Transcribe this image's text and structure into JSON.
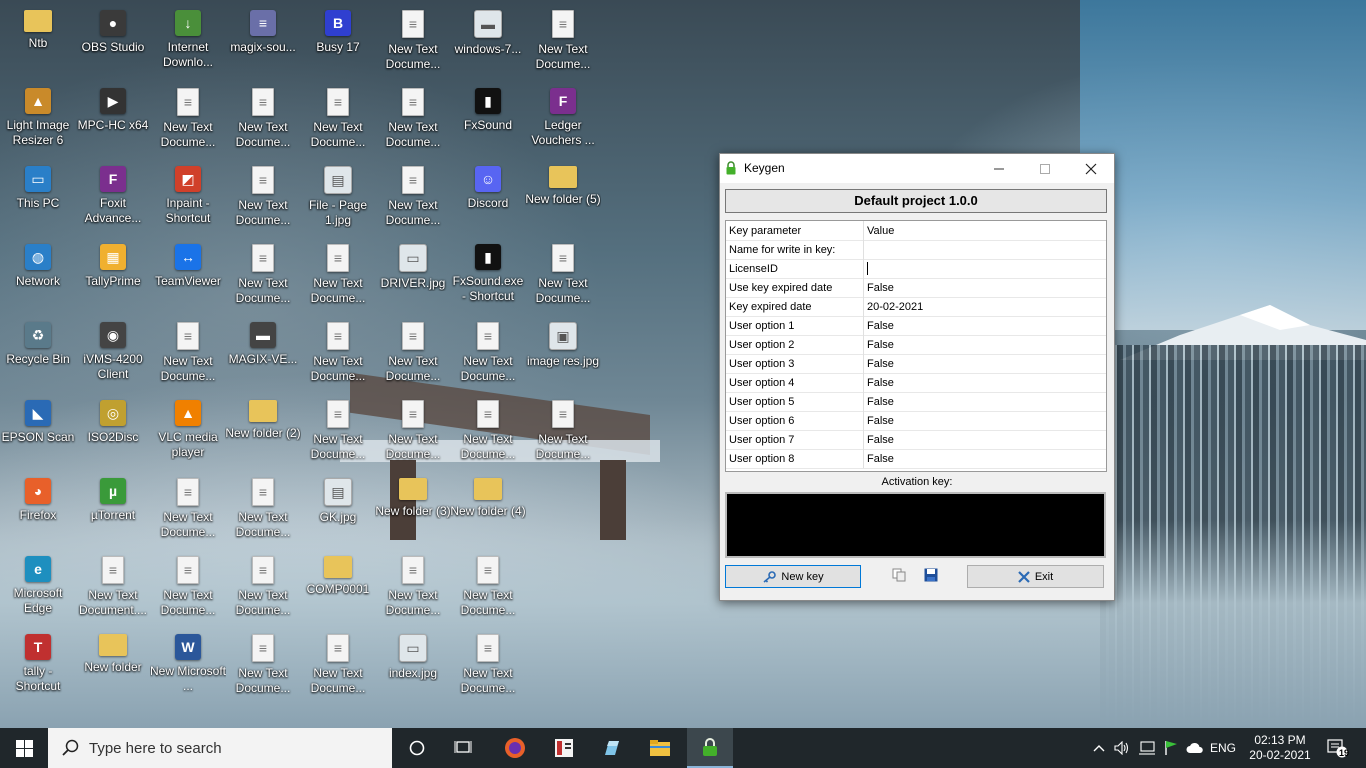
{
  "desktop": {
    "icons": [
      {
        "label": "Ntb",
        "kind": "folder",
        "glyph": ""
      },
      {
        "label": "OBS Studio",
        "kind": "app",
        "glyph": "●",
        "color": "#3a3a3a"
      },
      {
        "label": "Internet Downlo...",
        "kind": "app",
        "glyph": "↓",
        "color": "#4a8f3a"
      },
      {
        "label": "magix-sou...",
        "kind": "app",
        "glyph": "≡",
        "color": "#6a6fa8"
      },
      {
        "label": "Busy 17",
        "kind": "app",
        "glyph": "B",
        "color": "#2f3fd0"
      },
      {
        "label": "New Text Docume...",
        "kind": "doc",
        "glyph": "≡"
      },
      {
        "label": "windows-7...",
        "kind": "img",
        "glyph": "▬"
      },
      {
        "label": "New Text Docume...",
        "kind": "doc",
        "glyph": "≡"
      },
      {
        "label": "Light Image Resizer 6",
        "kind": "app",
        "glyph": "▲",
        "color": "#c98a2a"
      },
      {
        "label": "MPC-HC x64",
        "kind": "app",
        "glyph": "▶",
        "color": "#333"
      },
      {
        "label": "New Text Docume...",
        "kind": "doc",
        "glyph": "≡"
      },
      {
        "label": "New Text Docume...",
        "kind": "doc",
        "glyph": "≡"
      },
      {
        "label": "New Text Docume...",
        "kind": "doc",
        "glyph": "≡"
      },
      {
        "label": "New Text Docume...",
        "kind": "doc",
        "glyph": "≡"
      },
      {
        "label": "FxSound",
        "kind": "app",
        "glyph": "▮",
        "color": "#111"
      },
      {
        "label": "Ledger Vouchers ...",
        "kind": "app",
        "glyph": "F",
        "color": "#7b2f8e"
      },
      {
        "label": "This PC",
        "kind": "app",
        "glyph": "▭",
        "color": "#2a7fc8"
      },
      {
        "label": "Foxit Advance...",
        "kind": "app",
        "glyph": "F",
        "color": "#7b2f8e"
      },
      {
        "label": "Inpaint - Shortcut",
        "kind": "app",
        "glyph": "◩",
        "color": "#d0402a"
      },
      {
        "label": "New Text Docume...",
        "kind": "doc",
        "glyph": "≡"
      },
      {
        "label": "File - Page 1.jpg",
        "kind": "img",
        "glyph": "▤"
      },
      {
        "label": "New Text Docume...",
        "kind": "doc",
        "glyph": "≡"
      },
      {
        "label": "Discord",
        "kind": "app",
        "glyph": "☺",
        "color": "#5865f2"
      },
      {
        "label": "New folder (5)",
        "kind": "folder",
        "glyph": ""
      },
      {
        "label": "Network",
        "kind": "app",
        "glyph": "◍",
        "color": "#2a7fc8"
      },
      {
        "label": "TallyPrime",
        "kind": "app",
        "glyph": "▦",
        "color": "#f0b030"
      },
      {
        "label": "TeamViewer",
        "kind": "app",
        "glyph": "↔",
        "color": "#1a73e8"
      },
      {
        "label": "New Text Docume...",
        "kind": "doc",
        "glyph": "≡"
      },
      {
        "label": "New Text Docume...",
        "kind": "doc",
        "glyph": "≡"
      },
      {
        "label": "DRIVER.jpg",
        "kind": "img",
        "glyph": "▭"
      },
      {
        "label": "FxSound.exe - Shortcut",
        "kind": "app",
        "glyph": "▮",
        "color": "#111"
      },
      {
        "label": "New Text Docume...",
        "kind": "doc",
        "glyph": "≡"
      },
      {
        "label": "Recycle Bin",
        "kind": "app",
        "glyph": "♻",
        "color": "#5a7a8a"
      },
      {
        "label": "iVMS-4200 Client",
        "kind": "app",
        "glyph": "◉",
        "color": "#444"
      },
      {
        "label": "New Text Docume...",
        "kind": "doc",
        "glyph": "≡"
      },
      {
        "label": "MAGIX-VE...",
        "kind": "app",
        "glyph": "▬",
        "color": "#444"
      },
      {
        "label": "New Text Docume...",
        "kind": "doc",
        "glyph": "≡"
      },
      {
        "label": "New Text Docume...",
        "kind": "doc",
        "glyph": "≡"
      },
      {
        "label": "New Text Docume...",
        "kind": "doc",
        "glyph": "≡"
      },
      {
        "label": "image res.jpg",
        "kind": "img",
        "glyph": "▣"
      },
      {
        "label": "EPSON Scan",
        "kind": "app",
        "glyph": "◣",
        "color": "#2a6ab5"
      },
      {
        "label": "ISO2Disc",
        "kind": "app",
        "glyph": "◎",
        "color": "#c0a030"
      },
      {
        "label": "VLC media player",
        "kind": "app",
        "glyph": "▲",
        "color": "#f08000"
      },
      {
        "label": "New folder (2)",
        "kind": "folder",
        "glyph": ""
      },
      {
        "label": "New Text Docume...",
        "kind": "doc",
        "glyph": "≡"
      },
      {
        "label": "New Text Docume...",
        "kind": "doc",
        "glyph": "≡"
      },
      {
        "label": "New Text Docume...",
        "kind": "doc",
        "glyph": "≡"
      },
      {
        "label": "New Text Docume...",
        "kind": "doc",
        "glyph": "≡"
      },
      {
        "label": "Firefox",
        "kind": "app",
        "glyph": "◕",
        "color": "#e8602a"
      },
      {
        "label": "µTorrent",
        "kind": "app",
        "glyph": "µ",
        "color": "#3a9a3a"
      },
      {
        "label": "New Text Docume...",
        "kind": "doc",
        "glyph": "≡"
      },
      {
        "label": "New Text Docume...",
        "kind": "doc",
        "glyph": "≡"
      },
      {
        "label": "GK.jpg",
        "kind": "img",
        "glyph": "▤"
      },
      {
        "label": "New folder (3)",
        "kind": "folder",
        "glyph": ""
      },
      {
        "label": "New folder (4)",
        "kind": "folder",
        "glyph": ""
      },
      {
        "label": "",
        "kind": "none",
        "glyph": ""
      },
      {
        "label": "Microsoft Edge",
        "kind": "app",
        "glyph": "e",
        "color": "#1e8fbf"
      },
      {
        "label": "New Text Document....",
        "kind": "doc",
        "glyph": "≡"
      },
      {
        "label": "New Text Docume...",
        "kind": "doc",
        "glyph": "≡"
      },
      {
        "label": "New Text Docume...",
        "kind": "doc",
        "glyph": "≡"
      },
      {
        "label": "COMP0001",
        "kind": "folder",
        "glyph": ""
      },
      {
        "label": "New Text Docume...",
        "kind": "doc",
        "glyph": "≡"
      },
      {
        "label": "New Text Docume...",
        "kind": "doc",
        "glyph": "≡"
      },
      {
        "label": "",
        "kind": "none",
        "glyph": ""
      },
      {
        "label": "tally - Shortcut",
        "kind": "app",
        "glyph": "T",
        "color": "#c03030"
      },
      {
        "label": "New folder",
        "kind": "folder",
        "glyph": ""
      },
      {
        "label": "New Microsoft ...",
        "kind": "app",
        "glyph": "W",
        "color": "#2b579a"
      },
      {
        "label": "New Text Docume...",
        "kind": "doc",
        "glyph": "≡"
      },
      {
        "label": "New Text Docume...",
        "kind": "doc",
        "glyph": "≡"
      },
      {
        "label": "index.jpg",
        "kind": "img",
        "glyph": "▭"
      },
      {
        "label": "New Text Docume...",
        "kind": "doc",
        "glyph": "≡"
      },
      {
        "label": "",
        "kind": "none",
        "glyph": ""
      }
    ]
  },
  "keygen": {
    "title": "Keygen",
    "project_title": "Default project 1.0.0",
    "grid_header": {
      "param": "Key parameter",
      "value": "Value"
    },
    "rows": [
      {
        "param": "Name for write in key:",
        "value": ""
      },
      {
        "param": "LicenseID",
        "value": ""
      },
      {
        "param": "Use key expired date",
        "value": "False"
      },
      {
        "param": "Key expired date",
        "value": "20-02-2021"
      },
      {
        "param": "User option 1",
        "value": "False"
      },
      {
        "param": "User option 2",
        "value": "False"
      },
      {
        "param": "User option 3",
        "value": "False"
      },
      {
        "param": "User option 4",
        "value": "False"
      },
      {
        "param": "User option 5",
        "value": "False"
      },
      {
        "param": "User option 6",
        "value": "False"
      },
      {
        "param": "User option 7",
        "value": "False"
      },
      {
        "param": "User option 8",
        "value": "False"
      }
    ],
    "activation_label": "Activation key:",
    "activation_value": "",
    "new_key_label": "New key",
    "exit_label": "Exit"
  },
  "taskbar": {
    "search_placeholder": "Type here to search",
    "language": "ENG",
    "time": "02:13 PM",
    "date": "20-02-2021",
    "notification_count": "19",
    "pinned": [
      "task-view",
      "firefox",
      "app-book",
      "app-pen",
      "file-explorer",
      "keygen"
    ]
  },
  "colors": {
    "taskbar_bg": "#20272b",
    "search_bg": "#f3f3f3",
    "accent": "#0078d7"
  }
}
